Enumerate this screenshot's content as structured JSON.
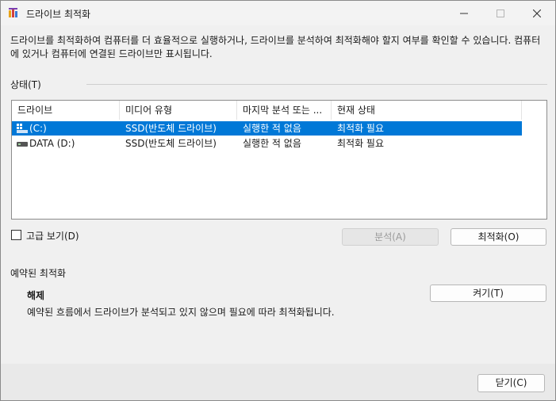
{
  "window": {
    "title": "드라이브 최적화",
    "minimize_icon": "minimize-icon",
    "maximize_icon": "maximize-icon",
    "close_icon": "close-icon"
  },
  "description": "드라이브를 최적화하여 컴퓨터를 더 효율적으로 실행하거나, 드라이브를 분석하여 최적화해야 할지 여부를 확인할 수 있습니다. 컴퓨터에 있거나 컴퓨터에 연결된 드라이브만 표시됩니다.",
  "status": {
    "label": "상태(T)",
    "columns": [
      "드라이브",
      "미디어 유형",
      "마지막 분석 또는 ...",
      "현재 상태"
    ],
    "rows": [
      {
        "drive": "(C:)",
        "media": "SSD(반도체 드라이브)",
        "last": "실행한 적 없음",
        "state": "최적화 필요",
        "icon": "system-drive-icon",
        "selected": true
      },
      {
        "drive": "DATA (D:)",
        "media": "SSD(반도체 드라이브)",
        "last": "실행한 적 없음",
        "state": "최적화 필요",
        "icon": "drive-icon",
        "selected": false
      }
    ]
  },
  "advanced": {
    "label": "고급 보기(D)",
    "checked": false
  },
  "buttons": {
    "analyze": "분석(A)",
    "optimize": "최적화(O)",
    "turn_on": "켜기(T)",
    "close": "닫기(C)"
  },
  "scheduled": {
    "label": "예약된 최적화",
    "state": "해제",
    "description": "예약된 흐름에서 드라이브가 분석되고 있지 않으며 필요에 따라 최적화됩니다."
  },
  "colors": {
    "selection": "#0078d7",
    "background": "#f0f0f0"
  }
}
